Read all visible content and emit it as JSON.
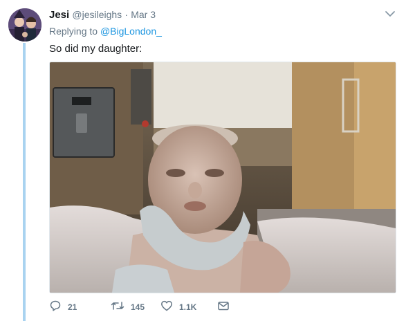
{
  "tweet": {
    "author_name": "Jesi",
    "handle": "@jesileighs",
    "separator": "·",
    "date": "Mar 3",
    "replying_prefix": "Replying to",
    "replying_to": "@BigLondon_",
    "text": "So did my daughter:"
  },
  "actions": {
    "reply_count": "21",
    "retweet_count": "145",
    "like_count": "1.1K"
  },
  "icons": {
    "reply": "reply-icon",
    "retweet": "retweet-icon",
    "like": "heart-icon",
    "message": "envelope-icon",
    "menu": "chevron-down-icon"
  },
  "colors": {
    "thread_line": "#a9d3f0",
    "link": "#1b95e0",
    "muted": "#657786"
  }
}
